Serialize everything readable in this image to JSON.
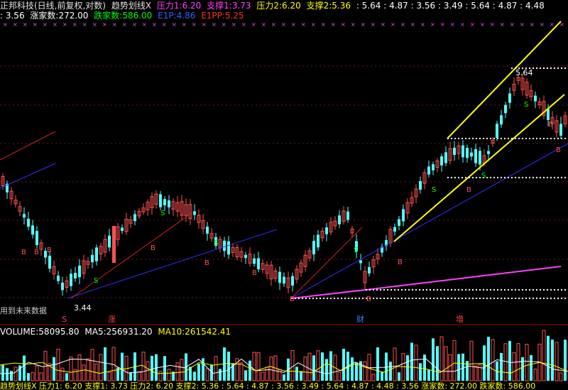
{
  "header": {
    "title": "正邦科技(日线,前复权,对数)",
    "indicator": "趋势划线X",
    "p1_label": "压力1:",
    "p1_value": "6.20",
    "s1_label": "支撑1:",
    "s1_value": "3.73",
    "p2_label": "压力2:",
    "p2_value": "6.20",
    "s2_label": "支撑2:",
    "s2_value": "5.36",
    "extra1": ": 5.64 : 4.87 : 3.56 : 3.49 : 5.64 : 4.87 : 4.48",
    "extra2": ": 3.56",
    "up_label": "涨家数:",
    "up_value": "272.00",
    "down_label": "跌家数:",
    "down_value": "586.00",
    "e1p_label": "E1P:",
    "e1p_value": "4.86",
    "e1pp_label": "E1PP:",
    "e1pp_value": "5.25"
  },
  "annotations": {
    "high_price": "5.64",
    "low_price": "3.44",
    "future_note": "用到未来数据",
    "mark_s": "S",
    "mark_zhang": "涨",
    "mark_cai": "财",
    "mark_zeng": "增"
  },
  "volume": {
    "label": "VOLUME:",
    "value": "58095.80",
    "ma5_label": "MA5:",
    "ma5_value": "256931.20",
    "ma10_label": "MA10:",
    "ma10_value": "261542.41"
  },
  "bottom_strip": {
    "text": "趋势划线X 压力1: 6.20 支撑1: 3.73 压力2: 6.20 支撑2: 5.36 : 5.64 : 4.87 : 3.56 : 3.49 : 5.64 : 4.87 : 4.48 : 3.56 涨家数: 272.00 跌家数: 586.00"
  },
  "colors": {
    "up": "#ff5050",
    "down": "#54ffff",
    "support": "#ffff00",
    "trend_blue": "#3030ff",
    "trend_red": "#d02020",
    "magenta": "#ff40ff",
    "white_line": "#ffffff"
  }
}
